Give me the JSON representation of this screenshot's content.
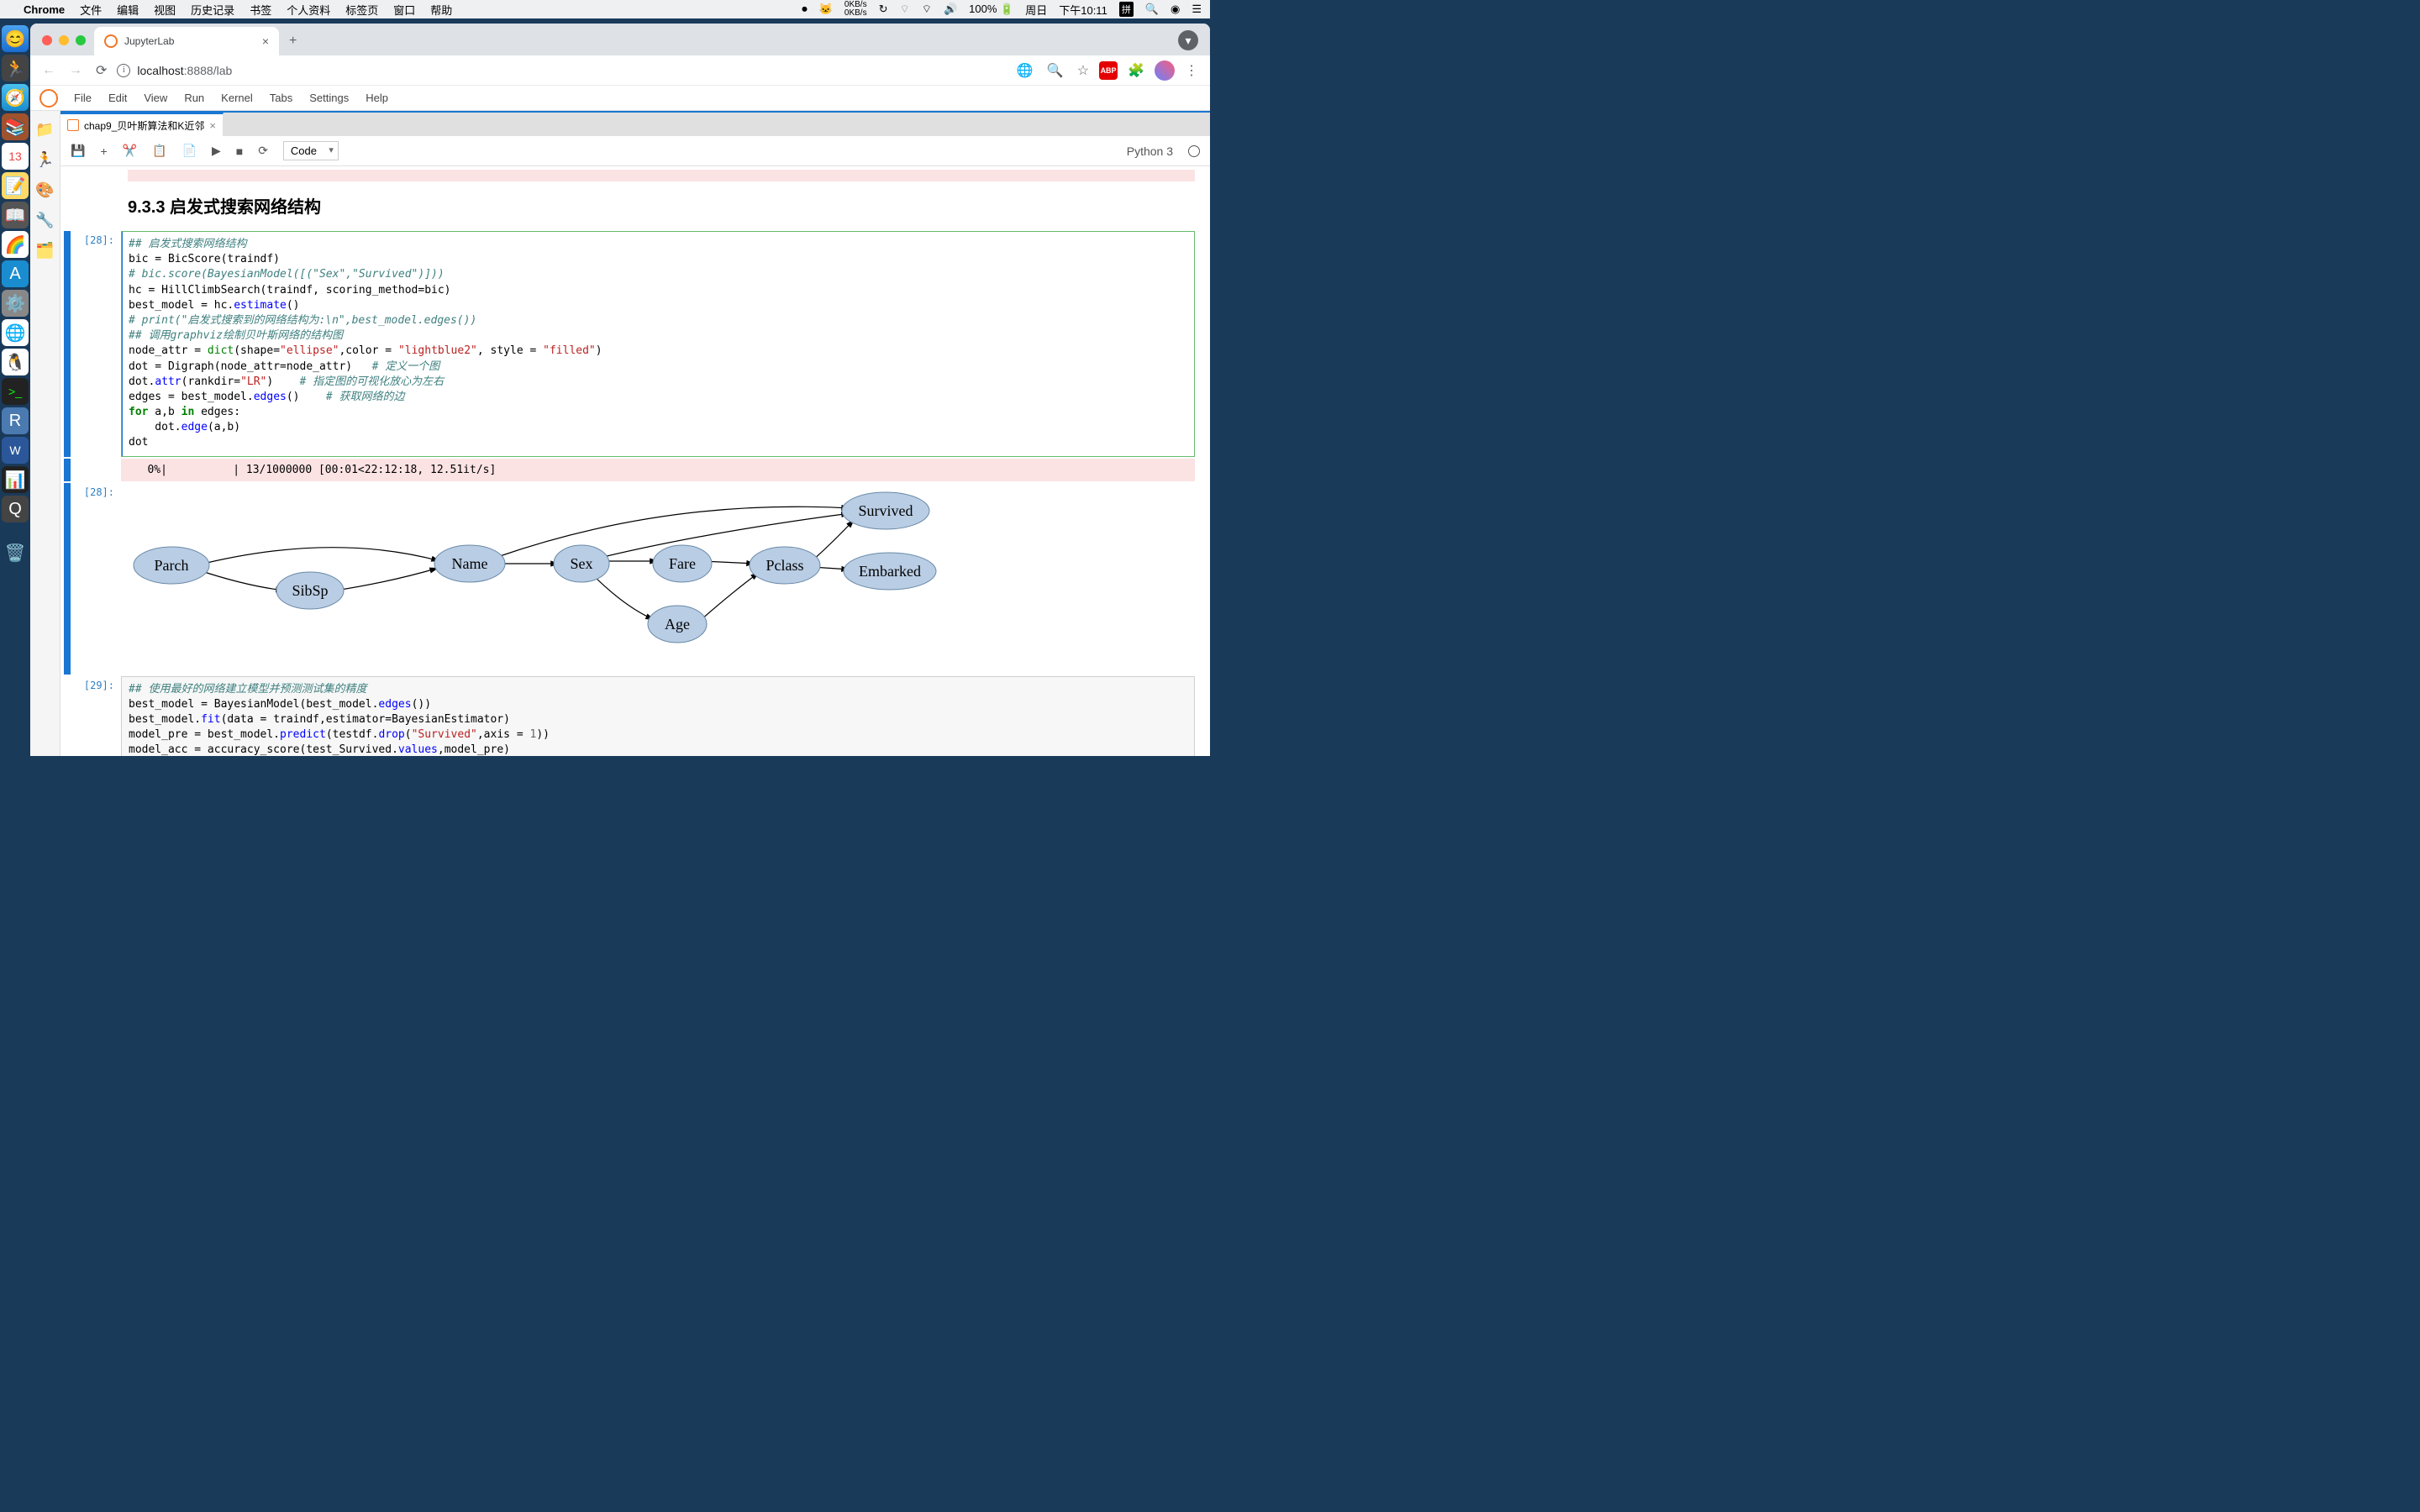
{
  "menubar": {
    "apple": "",
    "app": "Chrome",
    "items": [
      "文件",
      "编辑",
      "视图",
      "历史记录",
      "书签",
      "个人资料",
      "标签页",
      "窗口",
      "帮助"
    ],
    "net_up": "0KB/s",
    "net_down": "0KB/s",
    "battery": "100%",
    "day": "周日",
    "time": "下午10:11",
    "ime": "拼"
  },
  "chrome": {
    "tab_title": "JupyterLab",
    "url_host": "localhost",
    "url_path": ":8888/lab",
    "abp": "ABP"
  },
  "jlab_menu": [
    "File",
    "Edit",
    "View",
    "Run",
    "Kernel",
    "Tabs",
    "Settings",
    "Help"
  ],
  "nb_tab": "chap9_贝叶斯算法和K近邻",
  "toolbar": {
    "celltype": "Code",
    "kernel": "Python 3"
  },
  "heading": "9.3.3 启发式搜索网络结构",
  "cell28_prompt": "[28]:",
  "cell28_out_prompt": "[28]:",
  "cell29_prompt": "[29]:",
  "progress": "   0%|          | 13/1000000 [00:01<22:12:18, 12.51it/s]",
  "code28": {
    "l1": "## 启发式搜索网络结构",
    "l2a": "bic = BicScore(traindf)",
    "l3": "# bic.score(BayesianModel([(\"Sex\",\"Survived\")]))",
    "l4a": "hc = HillClimbSearch(traindf, scoring_method=bic)",
    "l5a": "best_model = hc.",
    "l5b": "estimate",
    "l5c": "()",
    "l6": "# print(\"启发式搜索到的网络结构为:\\n\",best_model.edges())",
    "l7": "## 调用graphviz绘制贝叶斯网络的结构图",
    "l8a": "node_attr = ",
    "l8b": "dict",
    "l8c": "(shape=",
    "l8d": "\"ellipse\"",
    "l8e": ",color = ",
    "l8f": "\"lightblue2\"",
    "l8g": ", style = ",
    "l8h": "\"filled\"",
    "l8i": ")",
    "l9a": "dot = Digraph(node_attr=node_attr)   ",
    "l9b": "# 定义一个图",
    "l10a": "dot.",
    "l10b": "attr",
    "l10c": "(rankdir=",
    "l10d": "\"LR\"",
    "l10e": ")    ",
    "l10f": "# 指定图的可视化放心为左右",
    "l11a": "edges = best_model.",
    "l11b": "edges",
    "l11c": "()    ",
    "l11d": "# 获取网络的边",
    "l12a": "for",
    "l12b": " a,b ",
    "l12c": "in",
    "l12d": " edges:",
    "l13a": "    dot.",
    "l13b": "edge",
    "l13c": "(a,b)",
    "l14": "dot"
  },
  "code29": {
    "l1": "## 使用最好的网络建立模型并预测测试集的精度",
    "l2a": "best_model = BayesianModel(best_model.",
    "l2b": "edges",
    "l2c": "())",
    "l3a": "best_model.",
    "l3b": "fit",
    "l3c": "(data = traindf,estimator=BayesianEstimator)",
    "l4a": "model_pre = best_model.",
    "l4b": "predict",
    "l4c": "(testdf.",
    "l4d": "drop",
    "l4e": "(",
    "l4f": "\"Survived\"",
    "l4g": ",axis = ",
    "l4h": "1",
    "l4i": "))",
    "l5a": "model_acc = accuracy_score(test_Survived.",
    "l5b": "values",
    "l5c": ",model_pre)"
  },
  "graph": {
    "nodes": [
      "Parch",
      "SibSp",
      "Name",
      "Sex",
      "Fare",
      "Age",
      "Pclass",
      "Survived",
      "Embarked"
    ]
  }
}
